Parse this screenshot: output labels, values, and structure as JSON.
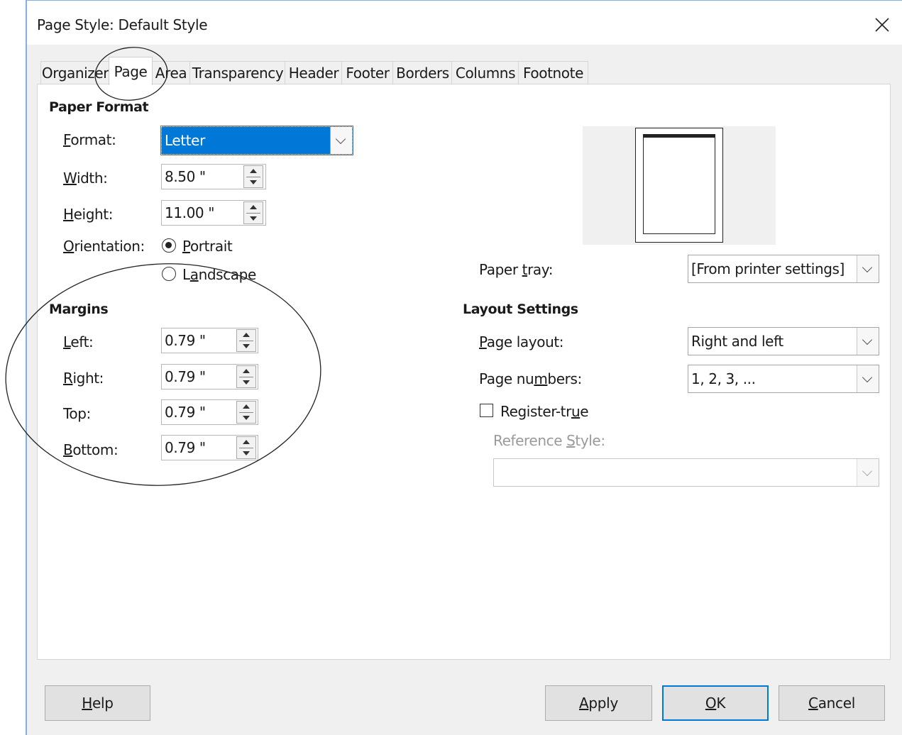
{
  "dialog": {
    "title": "Page Style: Default Style"
  },
  "tabs": [
    {
      "label": "Organizer"
    },
    {
      "label": "Page"
    },
    {
      "label": "Area"
    },
    {
      "label": "Transparency"
    },
    {
      "label": "Header"
    },
    {
      "label": "Footer"
    },
    {
      "label": "Borders"
    },
    {
      "label": "Columns"
    },
    {
      "label": "Footnote"
    }
  ],
  "paper_format": {
    "heading": "Paper Format",
    "format": {
      "label_u": "F",
      "label_rest": "ormat:",
      "value": "Letter"
    },
    "width": {
      "label_u": "W",
      "label_rest": "idth:",
      "value": "8.50 \""
    },
    "height": {
      "label_u": "H",
      "label_rest": "eight:",
      "value": "11.00 \""
    },
    "orientation": {
      "label_u": "O",
      "label_rest": "rientation:",
      "portrait_u": "P",
      "portrait_rest": "ortrait",
      "landscape_pre": "L",
      "landscape_u": "a",
      "landscape_rest": "ndscape",
      "selected": "Portrait"
    }
  },
  "margins": {
    "heading": "Margins",
    "left": {
      "label_u": "L",
      "label_rest": "eft:",
      "value": "0.79 \""
    },
    "right": {
      "label_u": "R",
      "label_rest": "ight:",
      "value": "0.79 \""
    },
    "top": {
      "label": "Top:",
      "value": "0.79 \""
    },
    "bottom": {
      "label_u": "B",
      "label_rest": "ottom:",
      "value": "0.79 \""
    }
  },
  "paper_tray": {
    "label_pre": "Paper ",
    "label_u": "t",
    "label_rest": "ray:",
    "value": "[From printer settings]"
  },
  "layout_settings": {
    "heading": "Layout Settings",
    "page_layout": {
      "label_u": "P",
      "label_rest": "age layout:",
      "value": "Right and left"
    },
    "page_numbers": {
      "label_pre": "Page nu",
      "label_u": "m",
      "label_rest": "bers:",
      "value": "1, 2, 3, ..."
    },
    "register_true": {
      "label_pre": "Register-tr",
      "label_u": "u",
      "label_rest": "e",
      "checked": false
    },
    "reference_style": {
      "label_pre": "Reference ",
      "label_u": "S",
      "label_rest": "tyle:",
      "value": ""
    }
  },
  "buttons": {
    "help": {
      "u": "H",
      "rest": "elp"
    },
    "apply": {
      "u": "A",
      "rest": "pply"
    },
    "ok": {
      "u": "O",
      "rest": "K"
    },
    "cancel": {
      "u": "C",
      "rest": "ancel"
    }
  },
  "colors": {
    "selection": "#0078d7",
    "annotation": "#222222"
  }
}
